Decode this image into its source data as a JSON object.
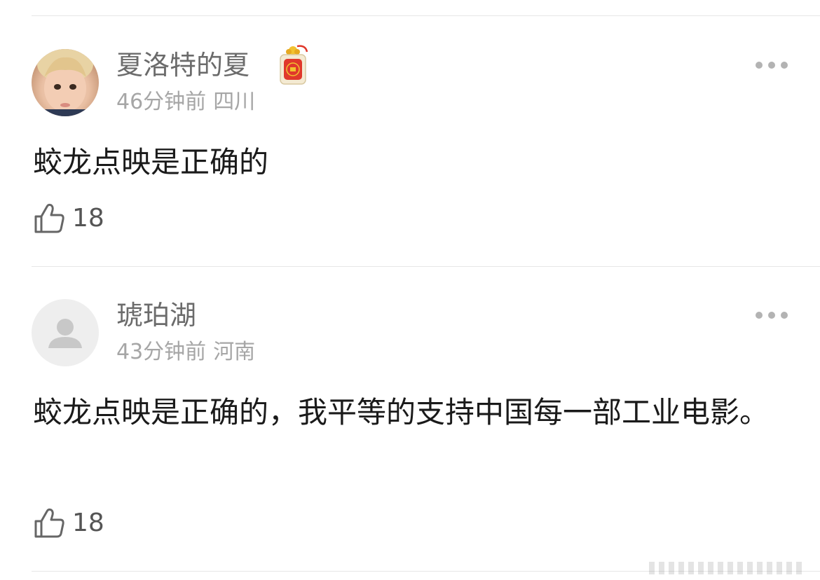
{
  "colors": {
    "username": "#6b6b6b",
    "meta": "#a6a6a6",
    "body_text": "#1a1a1a",
    "divider": "#e6e6e6",
    "badge_red": "#e0382b"
  },
  "comments": [
    {
      "username": "夏洛特的夏",
      "time": "46分钟前",
      "location": "四川",
      "text": "蛟龙点映是正确的",
      "likes": "18",
      "avatar": "child-photo-avatar",
      "badge": "lucky-charm-badge-icon"
    },
    {
      "username": "琥珀湖",
      "time": "43分钟前",
      "location": "河南",
      "text": "蛟龙点映是正确的，我平等的支持中国每一部工业电影。",
      "likes": "18",
      "avatar": "default-user-avatar-icon"
    }
  ]
}
